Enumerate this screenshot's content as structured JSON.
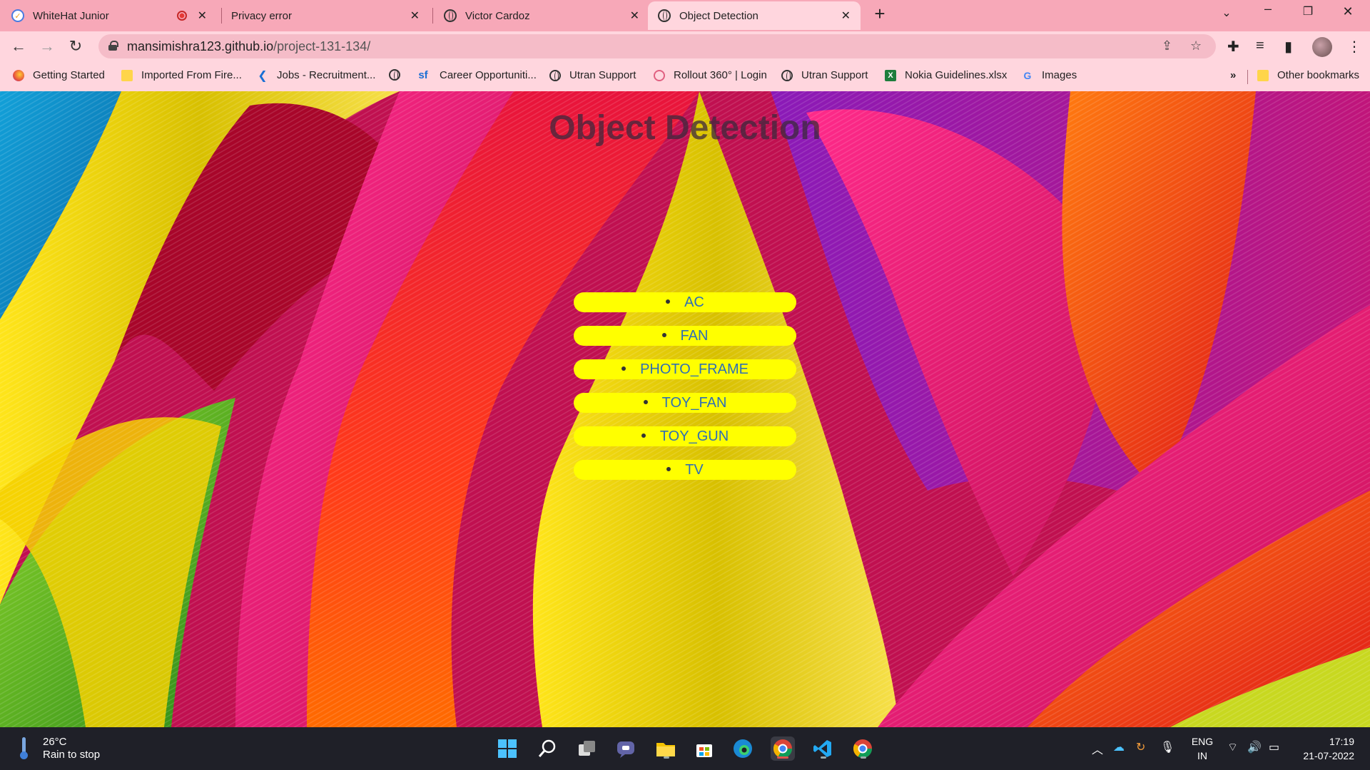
{
  "browser": {
    "tabs": [
      {
        "title": "WhiteHat Junior",
        "recording": true
      },
      {
        "title": "Privacy error"
      },
      {
        "title": "Victor Cardoz"
      },
      {
        "title": "Object Detection",
        "active": true
      }
    ],
    "new_tab_icon": "plus-icon",
    "url_host": "mansimishra123.github.io",
    "url_path": "/project-131-134/",
    "bookmarks": [
      {
        "label": "Getting Started",
        "icon": "firefox-icon"
      },
      {
        "label": "Imported From Fire...",
        "icon": "folder-icon"
      },
      {
        "label": "Jobs - Recruitment...",
        "icon": "k-logo-icon"
      },
      {
        "label": "",
        "icon": "globe-icon"
      },
      {
        "label": "Career Opportuniti...",
        "icon": "sf-logo-icon"
      },
      {
        "label": "Utran Support",
        "icon": "globe-icon"
      },
      {
        "label": "Rollout 360° | Login",
        "icon": "rollout-icon"
      },
      {
        "label": "Utran Support",
        "icon": "globe-icon"
      },
      {
        "label": "Nokia Guidelines.xlsx",
        "icon": "excel-icon"
      },
      {
        "label": "Images",
        "icon": "google-icon"
      }
    ],
    "overflow_label": "»",
    "other_bookmarks": "Other bookmarks"
  },
  "page": {
    "title": "Object Detection",
    "items": [
      "AC",
      "FAN",
      "PHOTO_FRAME",
      "TOY_FAN",
      "TOY_GUN",
      "TV"
    ],
    "item_bg": "#ffff00",
    "item_text_color": "#2f6fb5"
  },
  "taskbar": {
    "temperature": "26°C",
    "weather": "Rain to stop",
    "lang_top": "ENG",
    "lang_bottom": "IN",
    "time": "17:19",
    "date": "21-07-2022"
  }
}
